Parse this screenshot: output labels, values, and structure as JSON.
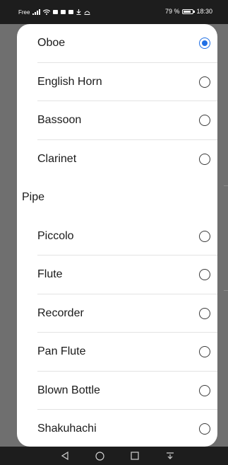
{
  "status_bar": {
    "carrier": "Free",
    "battery_text": "79 %",
    "battery_level_percent": 79,
    "time": "18:30",
    "icons": [
      "signal-icon",
      "wifi-icon",
      "message-icon",
      "image-icon",
      "image-icon",
      "download-icon",
      "data-saver-icon",
      "battery-icon"
    ]
  },
  "dialog": {
    "accent_color": "#1f6fe5",
    "rows": [
      {
        "type": "option",
        "label": "Oboe",
        "checked": true
      },
      {
        "type": "option",
        "label": "English Horn",
        "checked": false
      },
      {
        "type": "option",
        "label": "Bassoon",
        "checked": false
      },
      {
        "type": "option",
        "label": "Clarinet",
        "checked": false,
        "divider": false
      },
      {
        "type": "group",
        "label": "Pipe"
      },
      {
        "type": "option",
        "label": "Piccolo",
        "checked": false
      },
      {
        "type": "option",
        "label": "Flute",
        "checked": false
      },
      {
        "type": "option",
        "label": "Recorder",
        "checked": false
      },
      {
        "type": "option",
        "label": "Pan Flute",
        "checked": false
      },
      {
        "type": "option",
        "label": "Blown Bottle",
        "checked": false
      },
      {
        "type": "option",
        "label": "Shakuhachi",
        "checked": false,
        "divider": false
      }
    ]
  },
  "nav_bar": {
    "icons": [
      "back-icon",
      "home-icon",
      "recents-icon",
      "notification-pull-icon"
    ]
  }
}
